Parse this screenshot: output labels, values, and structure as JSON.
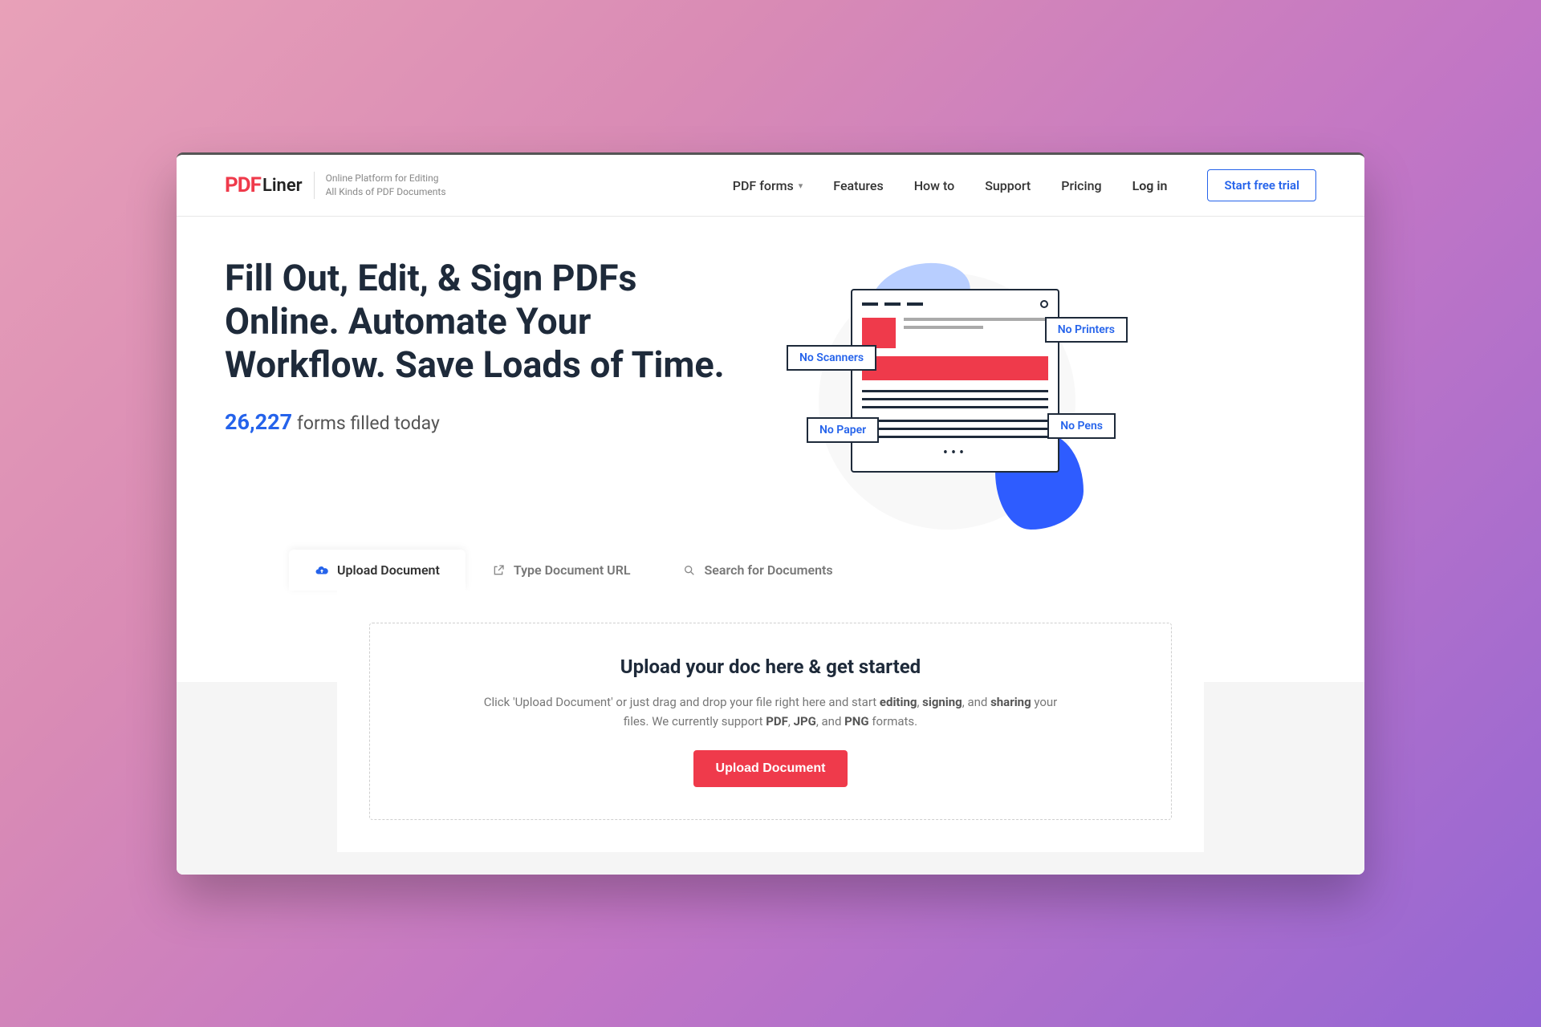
{
  "header": {
    "logo_pdf": "PDF",
    "logo_liner": "Liner",
    "tagline_line1": "Online Platform for Editing",
    "tagline_line2": "All Kinds of PDF Documents",
    "nav": {
      "pdf_forms": "PDF forms",
      "features": "Features",
      "how_to": "How to",
      "support": "Support",
      "pricing": "Pricing",
      "login": "Log in"
    },
    "cta": "Start free trial"
  },
  "hero": {
    "title": "Fill Out, Edit, & Sign PDFs Online. Automate Your Workflow. Save Loads of Time.",
    "stats_number": "26,227",
    "stats_label": "forms filled today",
    "badges": {
      "scanners": "No Scanners",
      "printers": "No Printers",
      "paper": "No Paper",
      "pens": "No Pens"
    }
  },
  "tabs": {
    "upload": "Upload Document",
    "url": "Type Document URL",
    "search": "Search for Documents"
  },
  "dropzone": {
    "title": "Upload your doc here & get started",
    "desc_1": "Click 'Upload Document' or just drag and drop your file right here and start ",
    "desc_editing": "editing",
    "desc_comma1": ", ",
    "desc_signing": "signing",
    "desc_comma2": ", and ",
    "desc_sharing": "sharing",
    "desc_3": " your files. We currently support ",
    "desc_pdf": "PDF",
    "desc_c3": ", ",
    "desc_jpg": "JPG",
    "desc_c4": ", and ",
    "desc_png": "PNG",
    "desc_end": " formats.",
    "button": "Upload Document"
  }
}
